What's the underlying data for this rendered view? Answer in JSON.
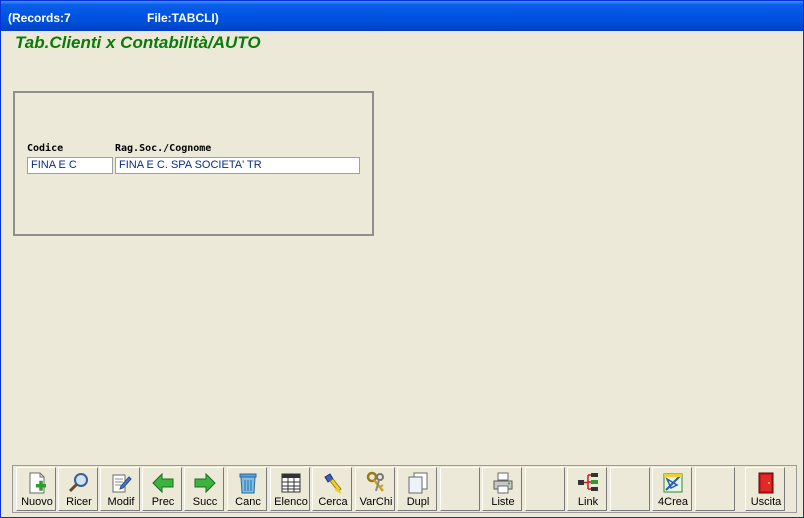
{
  "window": {
    "records_label": "(Records:7",
    "file_label": "File:TABCLI)"
  },
  "form": {
    "heading": "Tab.Clienti x Contabilità/AUTO",
    "codice_label": "Codice",
    "rag_soc_label": "Rag.Soc./Cognome",
    "codice_value": "FINA E C",
    "rag_soc_value": "FINA E C. SPA SOCIETA' TR"
  },
  "toolbar": {
    "buttons": [
      {
        "label": "Nuovo",
        "icon": "new-document-icon"
      },
      {
        "label": "Ricer",
        "icon": "magnifier-icon"
      },
      {
        "label": "Modif",
        "icon": "edit-document-icon"
      },
      {
        "label": "Prec",
        "icon": "arrow-left-icon"
      },
      {
        "label": "Succ",
        "icon": "arrow-right-icon"
      },
      {
        "label": "Canc",
        "icon": "trash-icon"
      },
      {
        "label": "Elenco",
        "icon": "list-grid-icon"
      },
      {
        "label": "Cerca",
        "icon": "flashlight-icon"
      },
      {
        "label": "VarChi",
        "icon": "keys-icon"
      },
      {
        "label": "Dupl",
        "icon": "duplicate-icon"
      },
      {
        "label": "",
        "icon": ""
      },
      {
        "label": "Liste",
        "icon": "printer-icon"
      },
      {
        "label": "",
        "icon": ""
      },
      {
        "label": "Link",
        "icon": "link-tree-icon"
      },
      {
        "label": "",
        "icon": ""
      },
      {
        "label": "4Crea",
        "icon": "design-tools-icon"
      },
      {
        "label": "",
        "icon": ""
      },
      {
        "label": "Uscita",
        "icon": "exit-door-icon"
      }
    ]
  },
  "colors": {
    "heading": "#0a7a0a",
    "field_text": "#0a2b8c",
    "titlebar": "#0055e5",
    "background": "#ece9d8"
  }
}
